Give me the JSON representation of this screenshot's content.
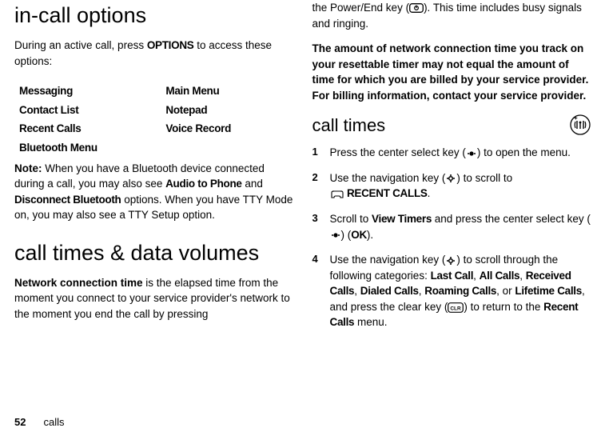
{
  "page": {
    "number": "52",
    "section": "calls"
  },
  "left": {
    "heading1": "in-call options",
    "p1_a": "During an active call, press ",
    "p1_options": "OPTIONS",
    "p1_b": " to access these options:",
    "options": {
      "r1c1": "Messaging",
      "r1c2": "Main Menu",
      "r2c1": "Contact List",
      "r2c2": "Notepad",
      "r3c1": "Recent Calls",
      "r3c2": "Voice Record",
      "r4c1": "Bluetooth Menu"
    },
    "note_label": "Note:",
    "note_a": " When you have a Bluetooth device connected during a call, you may also see ",
    "note_audio": "Audio to Phone",
    "note_and": " and ",
    "note_disc": "Disconnect Bluetooth",
    "note_b": " options. When you have TTY Mode on, you may also see a TTY Setup option.",
    "heading2": "call times & data volumes",
    "p3_a": "Network connection time",
    "p3_b": " is the elapsed time from the moment you connect to your service provider's network to the moment you end the call by pressing"
  },
  "right": {
    "cont_a": "the Power/End key (",
    "cont_b": "). This time includes busy signals and ringing.",
    "p2": "The amount of network connection time you track on your resettable timer may not equal the amount of time for which you are billed by your service provider. For billing information, contact your service provider.",
    "heading": "call times",
    "steps": {
      "n1": "1",
      "s1_a": "Press the center select key (",
      "s1_b": ") to open the menu.",
      "n2": "2",
      "s2_a": "Use the navigation key (",
      "s2_b": ") to scroll to ",
      "s2_icon_label": "",
      "s2_recent": " RECENT CALLS",
      "s2_c": ".",
      "n3": "3",
      "s3_a": "Scroll to ",
      "s3_view": "View Timers",
      "s3_b": " and press the center select key (",
      "s3_c": ") (",
      "s3_ok": "OK",
      "s3_d": ").",
      "n4": "4",
      "s4_a": "Use the navigation key (",
      "s4_b": ") to scroll through the following categories: ",
      "s4_last": "Last Call",
      "s4_sep1": ", ",
      "s4_all": "All Calls",
      "s4_sep2": ", ",
      "s4_recv": "Received Calls",
      "s4_sep3": ", ",
      "s4_dial": "Dialed Calls",
      "s4_sep4": ", ",
      "s4_roam": "Roaming Calls",
      "s4_sep5": ", or ",
      "s4_life": "Lifetime Calls",
      "s4_c": ", and press the clear key (",
      "s4_d": ") to return to the ",
      "s4_recent": "Recent Calls",
      "s4_e": " menu."
    }
  }
}
